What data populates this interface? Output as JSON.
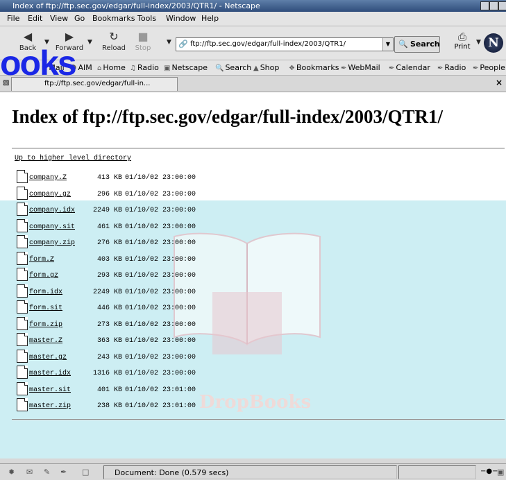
{
  "window": {
    "title": "Index of ftp://ftp.sec.gov/edgar/full-index/2003/QTR1/ - Netscape"
  },
  "menu": [
    "File",
    "Edit",
    "View",
    "Go",
    "Bookmarks",
    "Tools",
    "Window",
    "Help"
  ],
  "toolbar": {
    "back": "Back",
    "forward": "Forward",
    "reload": "Reload",
    "stop": "Stop",
    "url": "ftp://ftp.sec.gov/edgar/full-index/2003/QTR1/",
    "search": "Search",
    "print": "Print",
    "logo": "N"
  },
  "bookmarks": [
    "Mail",
    "AIM",
    "Home",
    "Radio",
    "Netscape",
    "Search",
    "Shop",
    "Bookmarks",
    "WebMail",
    "Calendar",
    "Radio",
    "People"
  ],
  "tab": {
    "title": "ftp://ftp.sec.gov/edgar/full-in...",
    "close": "×"
  },
  "page": {
    "heading": "Index of ftp://ftp.sec.gov/edgar/full-index/2003/QTR1/",
    "up_link": "Up to higher level directory",
    "files": [
      {
        "name": "company.Z",
        "size": "413 KB",
        "date": "01/10/02 23:00:00"
      },
      {
        "name": "company.gz",
        "size": "296 KB",
        "date": "01/10/02 23:00:00"
      },
      {
        "name": "company.idx",
        "size": "2249 KB",
        "date": "01/10/02 23:00:00"
      },
      {
        "name": "company.sit",
        "size": "461 KB",
        "date": "01/10/02 23:00:00"
      },
      {
        "name": "company.zip",
        "size": "276 KB",
        "date": "01/10/02 23:00:00"
      },
      {
        "name": "form.Z",
        "size": "403 KB",
        "date": "01/10/02 23:00:00"
      },
      {
        "name": "form.gz",
        "size": "293 KB",
        "date": "01/10/02 23:00:00"
      },
      {
        "name": "form.idx",
        "size": "2249 KB",
        "date": "01/10/02 23:00:00"
      },
      {
        "name": "form.sit",
        "size": "446 KB",
        "date": "01/10/02 23:00:00"
      },
      {
        "name": "form.zip",
        "size": "273 KB",
        "date": "01/10/02 23:00:00"
      },
      {
        "name": "master.Z",
        "size": "363 KB",
        "date": "01/10/02 23:00:00"
      },
      {
        "name": "master.gz",
        "size": "243 KB",
        "date": "01/10/02 23:00:00"
      },
      {
        "name": "master.idx",
        "size": "1316 KB",
        "date": "01/10/02 23:00:00"
      },
      {
        "name": "master.sit",
        "size": "401 KB",
        "date": "01/10/02 23:01:00"
      },
      {
        "name": "master.zip",
        "size": "238 KB",
        "date": "01/10/02 23:01:00"
      }
    ]
  },
  "status": {
    "text": "Document: Done (0.579 secs)"
  },
  "overlay": {
    "dropbooks": "ooks",
    "watermark": "DropBooks"
  },
  "colors": {
    "watermark_banner": "#cdeef3",
    "overlay_text": "#1a27e6"
  }
}
